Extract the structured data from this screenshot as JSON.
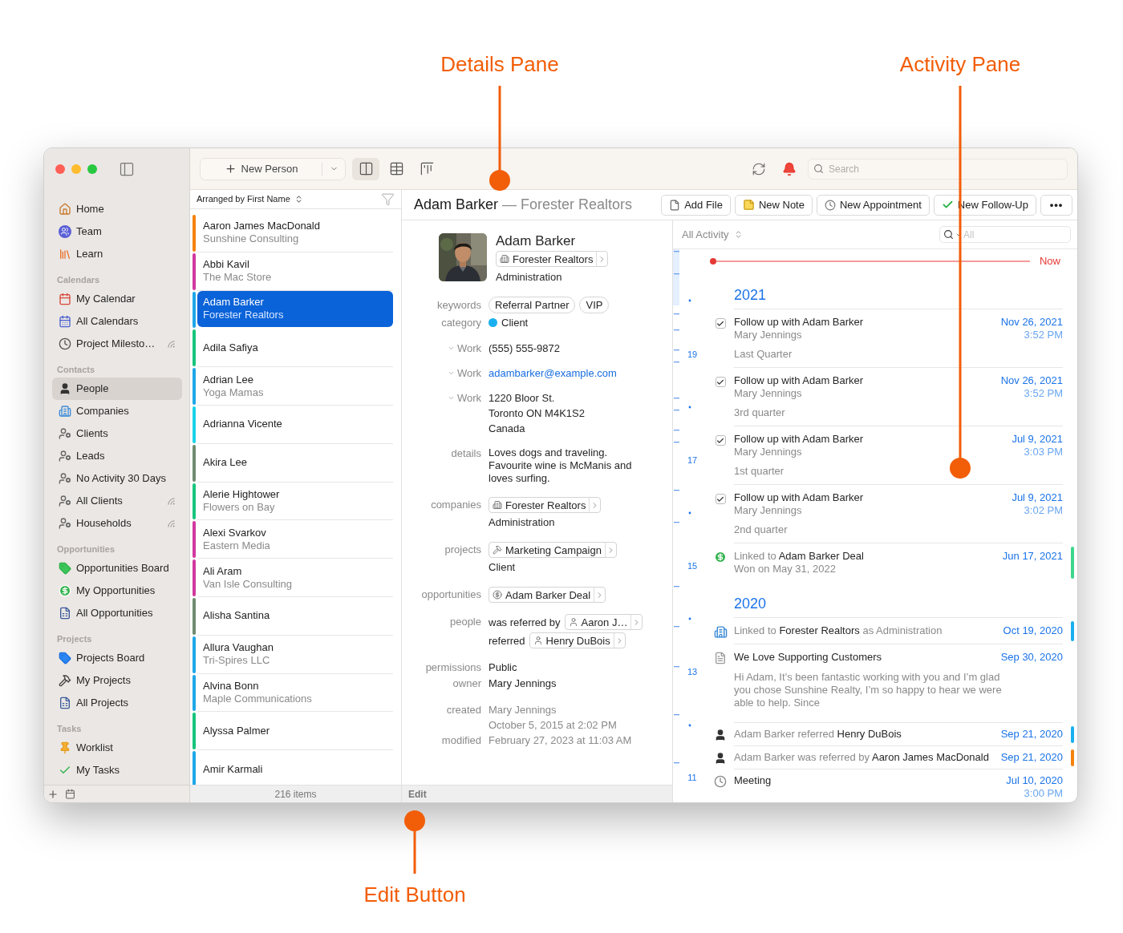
{
  "callouts": [
    {
      "label": "Details Pane"
    },
    {
      "label": "Activity Pane"
    },
    {
      "label": "Edit Button"
    }
  ],
  "sidebar": {
    "sections": [
      {
        "items": [
          {
            "label": "Home",
            "kind": "home",
            "selected": false,
            "shared": false
          },
          {
            "label": "Team",
            "kind": "team",
            "selected": false,
            "shared": false
          },
          {
            "label": "Learn",
            "kind": "learn",
            "selected": false,
            "shared": false
          }
        ]
      },
      {
        "heading": "Calendars",
        "items": [
          {
            "label": "My Calendar",
            "kind": "calendar",
            "selected": false,
            "shared": false
          },
          {
            "label": "All Calendars",
            "kind": "calendars",
            "selected": false,
            "shared": false
          },
          {
            "label": "Project Milesto…",
            "kind": "milestones",
            "selected": false,
            "shared": true
          }
        ]
      },
      {
        "heading": "Contacts",
        "items": [
          {
            "label": "People",
            "kind": "person",
            "selected": true,
            "shared": false
          },
          {
            "label": "Companies",
            "kind": "company",
            "selected": false,
            "shared": false
          },
          {
            "label": "Clients",
            "kind": "smart",
            "selected": false,
            "shared": false
          },
          {
            "label": "Leads",
            "kind": "smart",
            "selected": false,
            "shared": false
          },
          {
            "label": "No Activity 30 Days",
            "kind": "smart",
            "selected": false,
            "shared": false
          },
          {
            "label": "All Clients",
            "kind": "smart",
            "selected": false,
            "shared": true
          },
          {
            "label": "Households",
            "kind": "smart",
            "selected": false,
            "shared": true
          }
        ]
      },
      {
        "heading": "Opportunities",
        "items": [
          {
            "label": "Opportunities Board",
            "kind": "opportunityboard",
            "selected": false,
            "shared": false
          },
          {
            "label": "My Opportunities",
            "kind": "dollar",
            "selected": false,
            "shared": false
          },
          {
            "label": "All Opportunities",
            "kind": "ledger",
            "selected": false,
            "shared": false
          }
        ]
      },
      {
        "heading": "Projects",
        "items": [
          {
            "label": "Projects Board",
            "kind": "projectboard",
            "selected": false,
            "shared": false
          },
          {
            "label": "My Projects",
            "kind": "hammer",
            "selected": false,
            "shared": false
          },
          {
            "label": "All Projects",
            "kind": "ledger",
            "selected": false,
            "shared": false
          }
        ]
      },
      {
        "heading": "Tasks",
        "items": [
          {
            "label": "Worklist",
            "kind": "pin",
            "selected": false,
            "shared": false
          },
          {
            "label": "My Tasks",
            "kind": "check",
            "selected": false,
            "shared": false
          }
        ]
      }
    ]
  },
  "toolbar": {
    "new_button": "New Person",
    "search_placeholder": "Search",
    "views": [
      {
        "kind": "split",
        "selected": true
      },
      {
        "kind": "table",
        "selected": false
      },
      {
        "kind": "board",
        "selected": false
      }
    ]
  },
  "list": {
    "sort_label": "Arranged by First Name",
    "count": "216 items",
    "items": [
      {
        "name": "Aaron James MacDonald",
        "company": "Sunshine Consulting",
        "color": "#f5820d",
        "selected": false
      },
      {
        "name": "Abbi Kavil",
        "company": "The Mac Store",
        "color": "#d1399f",
        "selected": false
      },
      {
        "name": "Adam Barker",
        "company": "Forester Realtors",
        "color": "#1ea7e8",
        "selected": true
      },
      {
        "name": "Adila Safiya",
        "color": "#17c47c",
        "selected": false
      },
      {
        "name": "Adrian Lee",
        "company": "Yoga Mamas",
        "color": "#1ea7e8",
        "selected": false
      },
      {
        "name": "Adrianna Vicente",
        "color": "#1bd3e8",
        "selected": false
      },
      {
        "name": "Akira Lee",
        "color": "#6f8a70",
        "selected": false
      },
      {
        "name": "Alerie Hightower",
        "company": "Flowers on Bay",
        "color": "#17c47c",
        "selected": false
      },
      {
        "name": "Alexi Svarkov",
        "company": "Eastern Media",
        "color": "#d1399f",
        "selected": false
      },
      {
        "name": "Ali Aram",
        "company": "Van Isle Consulting",
        "color": "#d1399f",
        "selected": false
      },
      {
        "name": "Alisha Santina",
        "color": "#6f8a70",
        "selected": false
      },
      {
        "name": "Allura Vaughan",
        "company": "Tri-Spires LLC",
        "color": "#1ea7e8",
        "selected": false
      },
      {
        "name": "Alvina Bonn",
        "company": "Maple Communications",
        "color": "#1ea7e8",
        "selected": false
      },
      {
        "name": "Alyssa Palmer",
        "color": "#17c47c",
        "selected": false
      },
      {
        "name": "Amir Karmali",
        "color": "#1ea7e8",
        "selected": false
      }
    ]
  },
  "header": {
    "name": "Adam Barker",
    "subtitle": "— Forester Realtors",
    "actions": [
      {
        "label": "Add File",
        "kind": "file"
      },
      {
        "label": "New Note",
        "kind": "note"
      },
      {
        "label": "New Appointment",
        "kind": "appointment"
      },
      {
        "label": "New Follow-Up",
        "kind": "followup"
      },
      {
        "label": "•••",
        "kind": "more"
      }
    ]
  },
  "details": {
    "name": "Adam Barker",
    "company": "Forester Realtors",
    "role": "Administration",
    "keywords_label": "keywords",
    "keywords": [
      "Referral Partner",
      "VIP"
    ],
    "category_label": "category",
    "category": {
      "label": "Client",
      "color": "#1ab0ef"
    },
    "fields": [
      {
        "kind": "phone",
        "label": "Work",
        "lines": [
          "(555) 555-9872"
        ]
      },
      {
        "kind": "email",
        "label": "Work",
        "lines": [
          "adambarker@example.com"
        ]
      },
      {
        "kind": "address",
        "label": "Work",
        "lines": [
          "1220 Bloor St.",
          "Toronto ON M4K1S2",
          "Canada"
        ]
      }
    ],
    "details_label": "details",
    "details_text": "Loves dogs and traveling. Favourite wine is McManis and loves surfing.",
    "links": [
      {
        "label": "companies",
        "chip": "Forester Realtors",
        "kind": "company",
        "sub": "Administration"
      },
      {
        "label": "projects",
        "chip": "Marketing Campaign",
        "kind": "project",
        "sub": "Client"
      },
      {
        "label": "opportunities",
        "chip": "Adam Barker Deal",
        "kind": "opportunity"
      }
    ],
    "people_label": "people",
    "people": [
      {
        "relation": "was referred by",
        "name": "Aaron J…"
      },
      {
        "relation": "referred",
        "name": "Henry DuBois"
      }
    ],
    "meta": [
      {
        "label": "permissions",
        "value": "Public"
      },
      {
        "label": "owner",
        "value": "Mary Jennings"
      }
    ],
    "history": [
      {
        "label": "created",
        "lines": [
          "Mary Jennings",
          "October 5, 2015 at 2:02 PM"
        ]
      },
      {
        "label": "modified",
        "lines": [
          "February 27, 2023 at 11:03 AM"
        ]
      }
    ],
    "edit": "Edit"
  },
  "activity": {
    "filter": "All Activity",
    "search_placeholder": "All",
    "now": "Now",
    "scale": [
      "19",
      "17",
      "15",
      "13",
      "11"
    ],
    "years": [
      {
        "year": "2021",
        "entries": [
          {
            "kind": "followup",
            "checked": true,
            "title": "Follow up with Adam Barker",
            "person": "Mary Jennings",
            "note": "Last Quarter",
            "date": "Nov 26, 2021",
            "time": "3:52 PM"
          },
          {
            "kind": "followup",
            "checked": true,
            "title": "Follow up with Adam Barker",
            "person": "Mary Jennings",
            "note": "3rd quarter",
            "date": "Nov 26, 2021",
            "time": "3:52 PM"
          },
          {
            "kind": "followup",
            "checked": true,
            "title": "Follow up with Adam Barker",
            "person": "Mary Jennings",
            "note": "1st quarter",
            "date": "Jul 9, 2021",
            "time": "3:03 PM"
          },
          {
            "kind": "followup",
            "checked": true,
            "title": "Follow up with Adam Barker",
            "person": "Mary Jennings",
            "note": "2nd quarter",
            "date": "Jul 9, 2021",
            "time": "3:02 PM"
          },
          {
            "kind": "opportunity",
            "text": "Linked to **Adam Barker Deal**",
            "sub": "Won on May 31, 2022",
            "date": "Jun 17, 2021",
            "color": "#3dd68c"
          }
        ]
      },
      {
        "year": "2020",
        "entries": [
          {
            "kind": "company",
            "text": "Linked to **Forester Realtors** as Administration",
            "date": "Oct 19, 2020",
            "color": "#1ab0ef"
          },
          {
            "kind": "note",
            "title": "We Love Supporting Customers",
            "body": "Hi Adam, It’s been fantastic working with you and I’m glad you chose Sunshine Realty, I’m so happy to hear we were able to help. Since",
            "date": "Sep 30, 2020"
          },
          {
            "kind": "referral",
            "text": "Adam Barker referred **Henry DuBois**",
            "date": "Sep 21, 2020",
            "color": "#1ab0ef"
          },
          {
            "kind": "referral",
            "text": "Adam Barker was referred by **Aaron James MacDonald**",
            "date": "Sep 21, 2020",
            "color": "#f5820d"
          },
          {
            "kind": "meeting",
            "title": "Meeting",
            "date": "Jul 10, 2020",
            "time": "3:00 PM"
          }
        ]
      }
    ]
  }
}
